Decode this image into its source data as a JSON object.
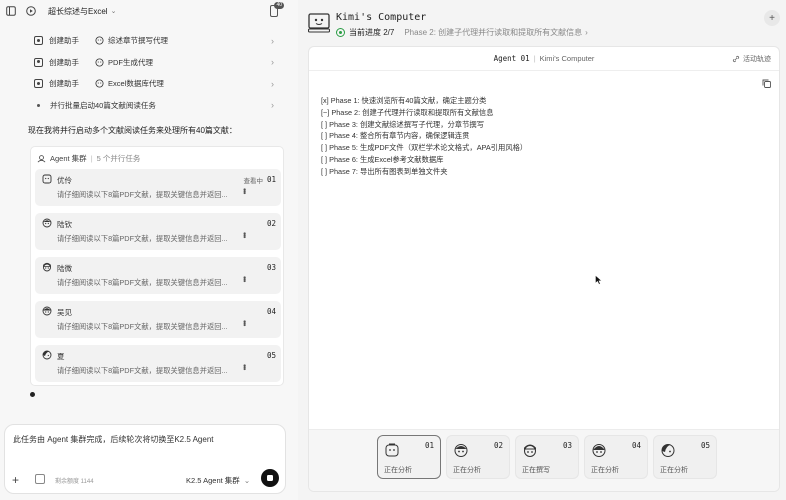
{
  "app": {
    "conversation_title": "超长综述与Excel",
    "phone_badge": "40"
  },
  "steps": [
    {
      "type": "agent",
      "action": "创建助手",
      "name": "综述章节撰写代理"
    },
    {
      "type": "agent",
      "action": "创建助手",
      "name": "PDF生成代理"
    },
    {
      "type": "agent",
      "action": "创建助手",
      "name": "Excel数据库代理"
    },
    {
      "type": "task",
      "name": "并行批量启动40篇文献阅读任务"
    }
  ],
  "intro_text": "现在我将并行启动多个文献阅读任务来处理所有40篇文献：",
  "swarm": {
    "title": "Agent 集群",
    "count": "5 个并行任务",
    "agents": [
      {
        "name": "优伶",
        "status": "查看中",
        "num": "01",
        "task": "请仔细阅读以下8篇PDF文献，提取关键信息并返回..."
      },
      {
        "name": "陆钦",
        "status": "",
        "num": "02",
        "task": "请仔细阅读以下8篇PDF文献，提取关键信息并返回..."
      },
      {
        "name": "陆微",
        "status": "",
        "num": "03",
        "task": "请仔细阅读以下8篇PDF文献，提取关键信息并返回..."
      },
      {
        "name": "吴见",
        "status": "",
        "num": "04",
        "task": "请仔细阅读以下8篇PDF文献，提取关键信息并返回..."
      },
      {
        "name": "夏",
        "status": "",
        "num": "05",
        "task": "请仔细阅读以下8篇PDF文献，提取关键信息并返回..."
      }
    ]
  },
  "composer": {
    "text": "此任务由 Agent 集群完成，后续轮次将切换至K2.5 Agent",
    "quota": "剩余额度 1144",
    "model": "K2.5 Agent 集群"
  },
  "computer": {
    "title": "Kimi's Computer",
    "progress_label": "当前进度 2/7",
    "phase_label": "Phase 2: 创建子代理并行读取和提取所有文献信息",
    "tab_agent": "Agent 01",
    "tab_computer": "Kimi's Computer",
    "track_label": "活动轨迹",
    "todo": [
      "[x] Phase 1: 快速浏览所有40篇文献，确定主题分类",
      "[~] Phase 2: 创建子代理并行读取和提取所有文献信息",
      "[ ] Phase 3: 创建文献综述撰写子代理，分章节撰写",
      "[ ] Phase 4: 整合所有章节内容，确保逻辑连贯",
      "[ ] Phase 5: 生成PDF文件（双栏学术论文格式，APA引用风格）",
      "[ ] Phase 6: 生成Excel参考文献数据库",
      "[ ] Phase 7: 导出所有图表到单独文件夹"
    ],
    "strip": [
      {
        "num": "01",
        "status": "正在分析",
        "active": true
      },
      {
        "num": "02",
        "status": "正在分析",
        "active": false
      },
      {
        "num": "03",
        "status": "正在撰写",
        "active": false
      },
      {
        "num": "04",
        "status": "正在分析",
        "active": false
      },
      {
        "num": "05",
        "status": "正在分析",
        "active": false
      }
    ]
  },
  "colors": {
    "accent_green": "#2a9d45",
    "send_button": "#111111"
  }
}
